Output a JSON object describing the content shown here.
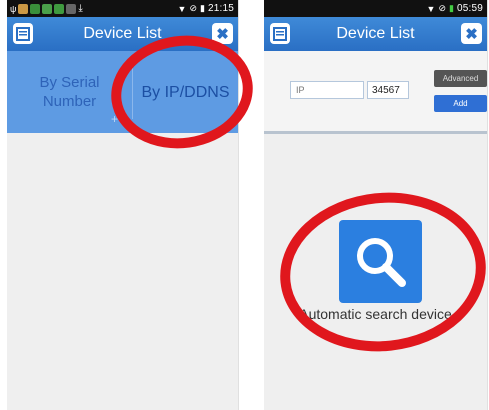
{
  "left": {
    "status": {
      "time": "21:15"
    },
    "title": "Device List",
    "tabs": [
      {
        "label": "By Serial Number"
      },
      {
        "label": "By IP/DDNS"
      }
    ]
  },
  "right": {
    "status": {
      "time": "05:59"
    },
    "title": "Device List",
    "ip_placeholder": "IP",
    "port_value": "34567",
    "advanced_label": "Advanced",
    "add_label": "Add",
    "search_label": "Automatic search device"
  },
  "colors": {
    "titlebar": "#2a6fc4",
    "tab_bg": "#5e9be3",
    "annotation": "#e0171d",
    "search_tile": "#2b7fe0"
  },
  "icons": {
    "menu": "menu-icon",
    "close": "close-icon",
    "search": "search-icon"
  }
}
